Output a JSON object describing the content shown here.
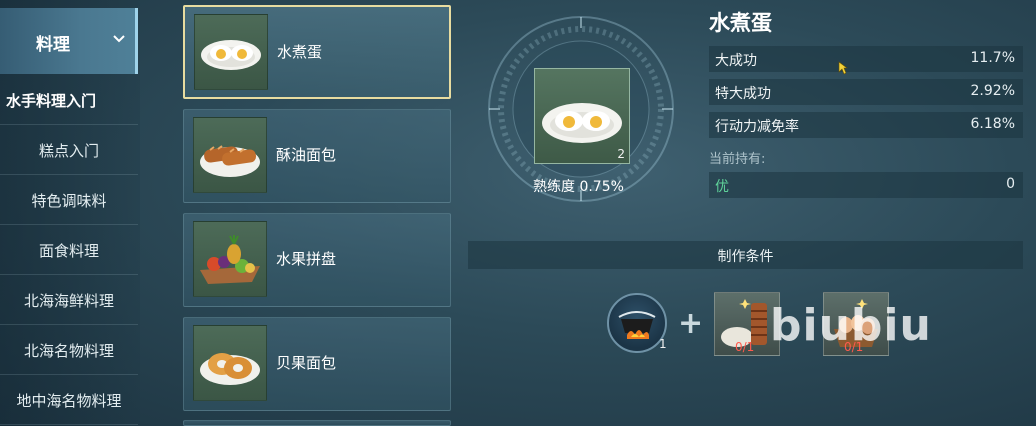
{
  "sidebar": {
    "header_label": "料理",
    "items": [
      {
        "label": "水手料理入门",
        "active": true
      },
      {
        "label": "糕点入门"
      },
      {
        "label": "特色调味料"
      },
      {
        "label": "面食料理"
      },
      {
        "label": "北海海鲜料理"
      },
      {
        "label": "北海名物料理"
      },
      {
        "label": "地中海名物料理"
      }
    ]
  },
  "recipes": [
    {
      "name": "水煮蛋",
      "icon": "boiled-egg-icon",
      "selected": true
    },
    {
      "name": "酥油面包",
      "icon": "butter-bread-icon"
    },
    {
      "name": "水果拼盘",
      "icon": "fruit-platter-icon"
    },
    {
      "name": "贝果面包",
      "icon": "bagel-icon"
    }
  ],
  "detail": {
    "title": "水煮蛋",
    "item_count": "2",
    "proficiency": "熟练度 0.75%",
    "stats": [
      {
        "name": "大成功",
        "value": "11.7%"
      },
      {
        "name": "特大成功",
        "value": "2.92%"
      },
      {
        "name": "行动力减免率",
        "value": "6.18%"
      }
    ],
    "holding_label": "当前持有:",
    "holding": {
      "grade": "优",
      "value": "0"
    }
  },
  "crafting": {
    "title": "制作条件",
    "tool_count": "1",
    "plus": "+",
    "ingredients": [
      {
        "icon": "flour-sack-icon",
        "count": "0/1"
      },
      {
        "icon": "eggs-basket-icon",
        "count": "0/1"
      }
    ]
  },
  "watermark": "biubiu",
  "colors": {
    "accent_gold": "#e8dca0",
    "holding_green": "#5fd39a",
    "shortage_red": "#ff5a4d"
  }
}
